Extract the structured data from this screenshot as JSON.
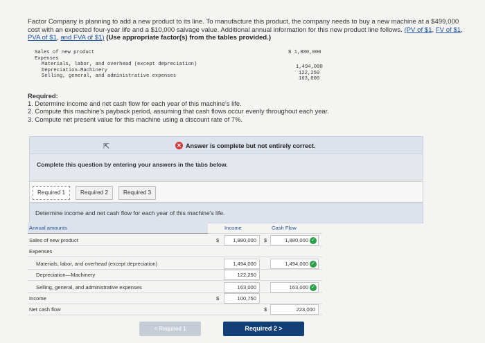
{
  "intro": {
    "text": "Factor Company is planning to add a new product to its line. To manufacture this product, the company needs to buy a new machine at a $499,000 cost with an expected four-year life and a $10,000 salvage value. Additional annual information for this new product line follows. ",
    "links": [
      "(PV of $1",
      "FV of $1",
      "PVA of $1",
      "and FVA of $1)"
    ],
    "bold_note": "(Use appropriate factor(s) from the tables provided.)"
  },
  "info_table": {
    "sales_label": "Sales of new product",
    "sales_value": "$ 1,880,000",
    "expenses_label": "Expenses",
    "items": [
      {
        "label": "Materials, labor, and overhead (except depreciation)",
        "value": "1,494,000"
      },
      {
        "label": "Depreciation—Machinery",
        "value": "122,250"
      },
      {
        "label": "Selling, general, and administrative expenses",
        "value": "163,000"
      }
    ]
  },
  "required": {
    "heading": "Required:",
    "items": [
      "1. Determine income and net cash flow for each year of this machine's life.",
      "2. Compute this machine's payback period, assuming that cash flows occur evenly throughout each year.",
      "3. Compute net present value for this machine using a discount rate of 7%."
    ]
  },
  "banner": {
    "text": "Answer is complete but not entirely correct."
  },
  "complete_text": "Complete this question by entering your answers in the tabs below.",
  "tabs": [
    "Required 1",
    "Required 2",
    "Required 3"
  ],
  "instruction": "Determine income and net cash flow for each year of this machine's life.",
  "answer_table": {
    "col_label": "Annual amounts",
    "col_income": "Income",
    "col_cashflow": "Cash Flow",
    "sales_label": "Sales of new product",
    "sales_income": "1,880,000",
    "sales_cf": "1,880,000",
    "expenses_label": "Expenses",
    "rows": [
      {
        "label": "Materials, labor, and overhead (except depreciation)",
        "income": "1,494,000",
        "cf": "1,494,000"
      },
      {
        "label": "Depreciation—Machinery",
        "income": "122,250",
        "cf": ""
      },
      {
        "label": "Selling, general, and administrative expenses",
        "income": "163,000",
        "cf": "163,000"
      }
    ],
    "income_label": "Income",
    "income_value": "100,750",
    "net_cf_label": "Net cash flow",
    "net_cf_value": "223,000",
    "dollar": "$"
  },
  "nav": {
    "prev": "< Required 1",
    "next": "Required 2  >"
  }
}
